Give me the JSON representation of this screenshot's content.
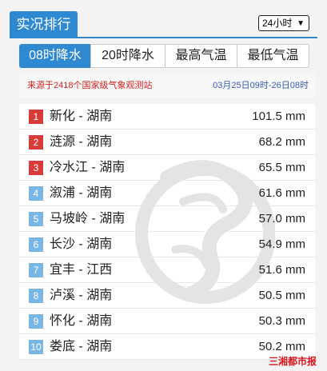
{
  "header": {
    "title": "实况排行",
    "period_select": "24小时"
  },
  "tabs": [
    {
      "label": "08时降水",
      "active": true
    },
    {
      "label": "20时降水",
      "active": false
    },
    {
      "label": "最高气温",
      "active": false
    },
    {
      "label": "最低气温",
      "active": false
    }
  ],
  "info": {
    "source": "来源于2418个国家级气象观测站",
    "time_range": "03月25日09时-26日08时"
  },
  "colors": {
    "accent": "#2f89d0",
    "rank_top": "#d93a3a",
    "rank_other": "#79b6e4"
  },
  "rows": [
    {
      "rank": "1",
      "station": "新化 - 湖南",
      "amount": "101.5 mm"
    },
    {
      "rank": "2",
      "station": "涟源 - 湖南",
      "amount": "68.2 mm"
    },
    {
      "rank": "3",
      "station": "冷水江 - 湖南",
      "amount": "65.5 mm"
    },
    {
      "rank": "4",
      "station": "溆浦 - 湖南",
      "amount": "61.6 mm"
    },
    {
      "rank": "5",
      "station": "马坡岭 - 湖南",
      "amount": "57.0 mm"
    },
    {
      "rank": "6",
      "station": "长沙 - 湖南",
      "amount": "54.9 mm"
    },
    {
      "rank": "7",
      "station": "宜丰 - 江西",
      "amount": "51.6 mm"
    },
    {
      "rank": "8",
      "station": "泸溪 - 湖南",
      "amount": "50.5 mm"
    },
    {
      "rank": "9",
      "station": "怀化 - 湖南",
      "amount": "50.3 mm"
    },
    {
      "rank": "10",
      "station": "娄底 - 湖南",
      "amount": "50.2 mm"
    }
  ],
  "watermark_logo": "三湘都市报"
}
